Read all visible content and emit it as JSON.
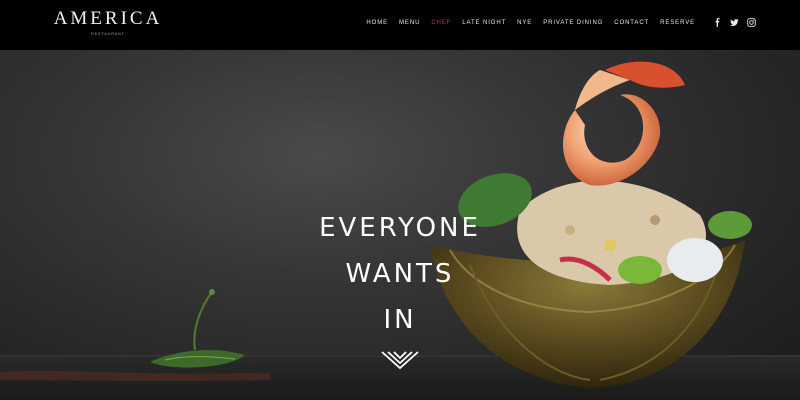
{
  "brand": {
    "name": "AMERICA",
    "sub": "RESTAURANT"
  },
  "nav": {
    "items": [
      {
        "label": "HOME"
      },
      {
        "label": "MENU"
      },
      {
        "label": "CHEF"
      },
      {
        "label": "LATE NIGHT"
      },
      {
        "label": "NYE"
      },
      {
        "label": "PRIVATE DINING"
      },
      {
        "label": "CONTACT"
      },
      {
        "label": "RESERVE"
      }
    ],
    "active": "CHEF",
    "active_color": "#b8324a"
  },
  "social": {
    "icons": [
      "facebook-icon",
      "twitter-icon",
      "instagram-icon"
    ]
  },
  "hero": {
    "headline": [
      "EVERYONE",
      "WANTS",
      "IN"
    ],
    "scroll_icon": "chevron-down-icon"
  },
  "colors": {
    "navbar": "#000000",
    "text": "#ffffff"
  }
}
